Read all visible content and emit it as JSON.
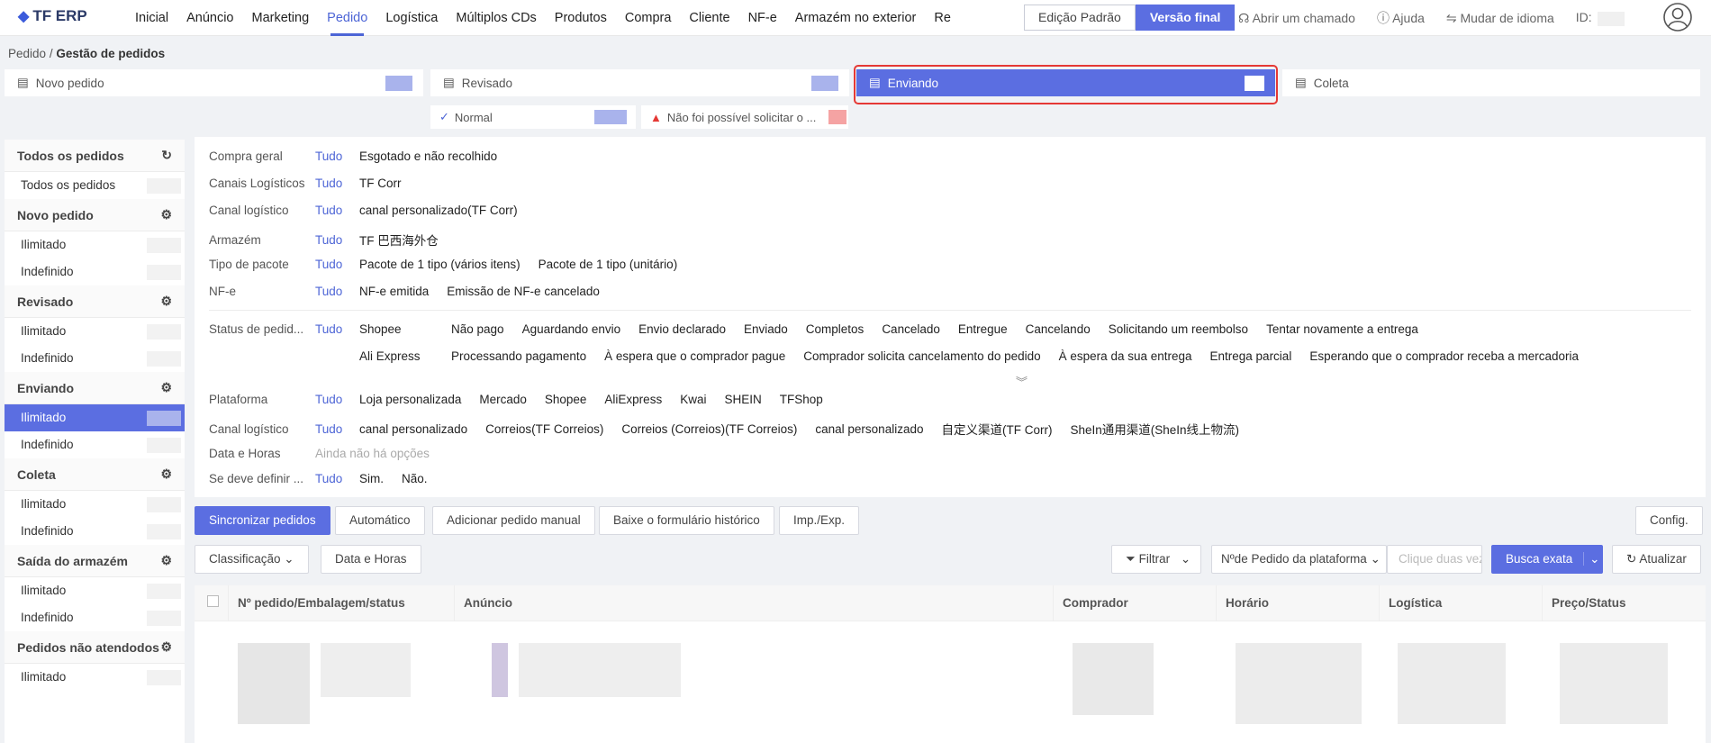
{
  "app": {
    "logo": "TF ERP"
  },
  "nav": {
    "items": [
      "Inicial",
      "Anúncio",
      "Marketing",
      "Pedido",
      "Logística",
      "Múltiplos CDs",
      "Produtos",
      "Compra",
      "Cliente",
      "NF-e",
      "Armazém no exterior",
      "Re"
    ],
    "active": "Pedido"
  },
  "edition": {
    "standard": "Edição Padrão",
    "final": "Versão final"
  },
  "toplinks": {
    "ticket": "Abrir um chamado",
    "help": "Ajuda",
    "language": "Mudar de idioma",
    "id_label": "ID:"
  },
  "breadcrumb": {
    "root": "Pedido",
    "current": "Gestão de pedidos"
  },
  "steps": [
    "Novo pedido",
    "Revisado",
    "Enviando",
    "Coleta"
  ],
  "substeps": {
    "normal": "Normal",
    "failed": "Não foi possível solicitar o ..."
  },
  "sidebar": {
    "all": {
      "title": "Todos os pedidos",
      "items": [
        "Todos os pedidos"
      ]
    },
    "groups": [
      {
        "title": "Novo pedido",
        "items": [
          "Ilimitado",
          "Indefinido"
        ]
      },
      {
        "title": "Revisado",
        "items": [
          "Ilimitado",
          "Indefinido"
        ]
      },
      {
        "title": "Enviando",
        "items": [
          "Ilimitado",
          "Indefinido"
        ]
      },
      {
        "title": "Coleta",
        "items": [
          "Ilimitado",
          "Indefinido"
        ]
      },
      {
        "title": "Saída do armazém",
        "items": [
          "Ilimitado",
          "Indefinido"
        ]
      },
      {
        "title": "Pedidos não atendodos",
        "items": [
          "Ilimitado"
        ]
      }
    ]
  },
  "filters": {
    "all_label": "Tudo",
    "rows": [
      {
        "label": "Compra geral",
        "options": [
          "Esgotado e não recolhido"
        ]
      },
      {
        "label": "Canais Logísticos",
        "options": [
          "TF Corr"
        ]
      },
      {
        "label": "Canal logístico",
        "options": [
          "canal personalizado(TF Corr)"
        ]
      },
      {
        "label": "Armazém",
        "options": [
          "TF 巴西海外仓"
        ]
      },
      {
        "label": "Tipo de pacote",
        "options": [
          "Pacote de 1 tipo (vários itens)",
          "Pacote de 1 tipo (unitário)"
        ]
      },
      {
        "label": "NF-e",
        "options": [
          "NF-e emitida",
          "Emissão de NF-e cancelado"
        ]
      }
    ],
    "status": {
      "label": "Status de pedid...",
      "shopee_label": "Shopee",
      "shopee": [
        "Não pago",
        "Aguardando envio",
        "Envio declarado",
        "Enviado",
        "Completos",
        "Cancelado",
        "Entregue",
        "Cancelando",
        "Solicitando um reembolso",
        "Tentar novamente a entrega"
      ],
      "ali_label": "Ali Express",
      "ali": [
        "Processando pagamento",
        "À espera que o comprador pague",
        "Comprador solicita cancelamento do pedido",
        "À espera da sua entrega",
        "Entrega parcial",
        "Esperando que o comprador receba a mercadoria"
      ]
    },
    "rows2": [
      {
        "label": "Plataforma",
        "options": [
          "Loja personalizada",
          "Mercado",
          "Shopee",
          "AliExpress",
          "Kwai",
          "SHEIN",
          "TFShop"
        ]
      },
      {
        "label": "Canal logístico",
        "options": [
          "canal personalizado",
          "Correios(TF Correios)",
          "Correios (Correios)(TF Correios)",
          "canal personalizado",
          "自定义渠道(TF Corr)",
          "SheIn通用渠道(SheIn线上物流)"
        ]
      }
    ],
    "datetime": {
      "label": "Data e Horas",
      "empty": "Ainda não há opções"
    },
    "should": {
      "label": "Se deve definir ...",
      "options": [
        "Sim.",
        "Não."
      ]
    }
  },
  "actions": {
    "sync": "Sincronizar pedidos",
    "auto": "Automático",
    "add_manual": "Adicionar pedido manual",
    "download_history": "Baixe o formulário histórico",
    "imp_exp": "Imp./Exp.",
    "config": "Config."
  },
  "toolbar": {
    "sort": "Classificação",
    "datetime": "Data e Horas",
    "filter": "Filtrar",
    "order_field": "Nºde Pedido da plataforma",
    "search_placeholder": "Clique duas vezes",
    "exact_search": "Busca exata",
    "refresh": "Atualizar"
  },
  "table": {
    "columns": [
      "Nº pedido/Embalagem/status",
      "Anúncio",
      "Comprador",
      "Horário",
      "Logística",
      "Preço/Status"
    ]
  },
  "colors": {
    "accent": "#5b6ee1",
    "highlight": "#e53935"
  }
}
